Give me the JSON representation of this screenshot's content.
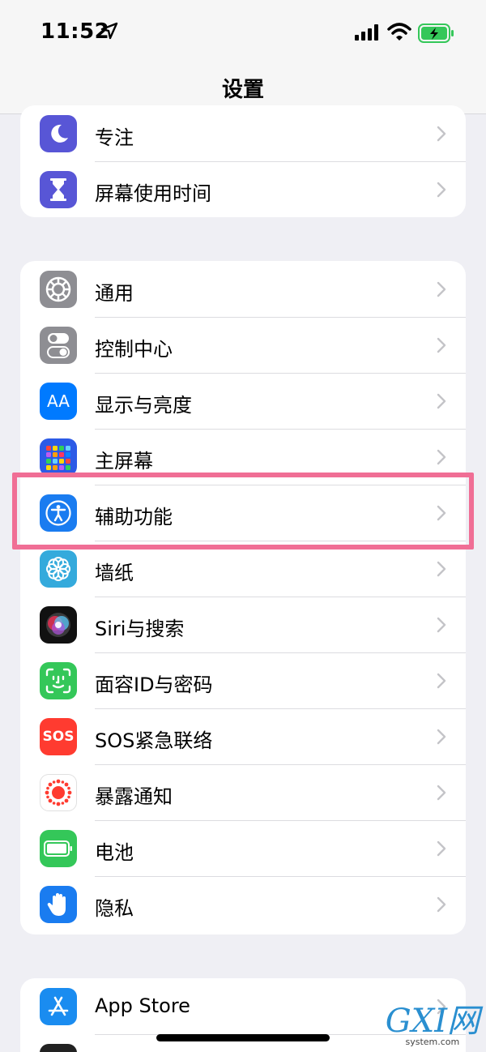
{
  "status": {
    "time": "11:52"
  },
  "nav": {
    "title": "设置"
  },
  "group1": [
    {
      "label": "专注",
      "icon": "moon-icon",
      "color": "#5856d6"
    },
    {
      "label": "屏幕使用时间",
      "icon": "hourglass-icon",
      "color": "#5856d6"
    }
  ],
  "group2": [
    {
      "label": "通用",
      "icon": "gear-icon",
      "color": "#8e8e93"
    },
    {
      "label": "控制中心",
      "icon": "toggles-icon",
      "color": "#8e8e93"
    },
    {
      "label": "显示与亮度",
      "icon": "text-size-icon",
      "color": "#007aff"
    },
    {
      "label": "主屏幕",
      "icon": "app-grid-icon",
      "color": "#2c5ae6"
    },
    {
      "label": "辅助功能",
      "icon": "accessibility-icon",
      "color": "#1a7cf0"
    },
    {
      "label": "墙纸",
      "icon": "flower-icon",
      "color": "#34aadc"
    },
    {
      "label": "Siri与搜索",
      "icon": "siri-icon",
      "color": "#111111"
    },
    {
      "label": "面容ID与密码",
      "icon": "face-id-icon",
      "color": "#34c759"
    },
    {
      "label": "SOS紧急联络",
      "icon": "sos-icon",
      "color": "#ff3b30"
    },
    {
      "label": "暴露通知",
      "icon": "exposure-icon",
      "color": "#ffffff"
    },
    {
      "label": "电池",
      "icon": "battery-icon",
      "color": "#34c759"
    },
    {
      "label": "隐私",
      "icon": "hand-icon",
      "color": "#1a7cf0"
    }
  ],
  "group3": [
    {
      "label": "App Store",
      "icon": "app-store-icon",
      "color": "#1a8cf0"
    }
  ],
  "sos_text": "SOS",
  "text_size_glyph": "AA",
  "watermark": {
    "logo": "GXI网",
    "domain": "system.com"
  },
  "highlight_color": "#f06e95"
}
